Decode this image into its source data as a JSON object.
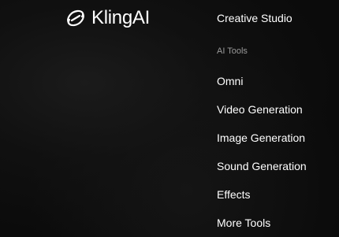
{
  "logo": {
    "text": "KlingAI",
    "icon": "kling-logo-icon"
  },
  "menu": {
    "top_item": "Creative Studio",
    "section_label": "AI Tools",
    "items": [
      "Omni",
      "Video Generation",
      "Image Generation",
      "Sound Generation",
      "Effects",
      "More Tools"
    ]
  },
  "colors": {
    "background": "#0b0b0b",
    "text": "#ffffff",
    "section": "#9a9a9a"
  }
}
